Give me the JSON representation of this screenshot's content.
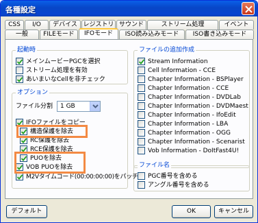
{
  "window": {
    "title": "各種設定"
  },
  "tabs_top": [
    "CSS",
    "I/O",
    "デバイス",
    "レジストリ",
    "サウンド",
    "ストリーム処理",
    "イベント"
  ],
  "tabs_bottom": [
    "一般",
    "FILEモード",
    "IFOモード",
    "ISO読み込みモード",
    "ISO書き込みモード"
  ],
  "active_tab": "IFOモード",
  "startup": {
    "title": "起動時",
    "items": [
      {
        "label": "メインムービーPGCを選択",
        "checked": true
      },
      {
        "label": "ストリーム処理を有効",
        "checked": false
      },
      {
        "label": "あいまいなCellを非チェック",
        "checked": true
      }
    ]
  },
  "options": {
    "title": "オプション",
    "file_split_label": "ファイル分割",
    "file_split_value": "1 GB",
    "items": [
      {
        "label": "IFOファイルをコピー",
        "checked": true
      },
      {
        "label": "構造保護を除去",
        "checked": true
      },
      {
        "label": "RC保護を除去",
        "checked": true
      },
      {
        "label": "RCE保護を除去",
        "checked": true
      },
      {
        "label": "PUOを除去",
        "checked": true
      },
      {
        "label": "VOB PUOを除去",
        "checked": true
      },
      {
        "label": "M2Vタイムコード(00:00:00:00)をパッチ",
        "checked": true
      }
    ]
  },
  "file_append": {
    "title": "ファイルの追加作成",
    "items": [
      {
        "label": "Stream Information",
        "checked": true
      },
      {
        "label": "Cell Information - CCE",
        "checked": false
      },
      {
        "label": "Chapter Information - BSPlayer",
        "checked": false
      },
      {
        "label": "Chapter Information - CCE",
        "checked": false
      },
      {
        "label": "Chapter Information - DVDLab",
        "checked": false
      },
      {
        "label": "Chapter Information - DVDMaestro",
        "checked": false
      },
      {
        "label": "Chapter Information - IfoEdit",
        "checked": false
      },
      {
        "label": "Chapter Information - LBA",
        "checked": false
      },
      {
        "label": "Chapter Information - OGG",
        "checked": false
      },
      {
        "label": "Chapter Information - Scenarist",
        "checked": false
      },
      {
        "label": "Vob Information - DoItFast4U!",
        "checked": false
      }
    ]
  },
  "filename": {
    "title": "ファイル名",
    "items": [
      {
        "label": "PGC番号を含める",
        "checked": false
      },
      {
        "label": "アングル番号を含める",
        "checked": false
      }
    ]
  },
  "buttons": {
    "default": "デフォルト",
    "ok": "OK",
    "cancel": "キャンセル"
  },
  "colors": {
    "highlight": "#f38a43",
    "group_title": "#0046d5",
    "title_bar": "#0846c7"
  }
}
